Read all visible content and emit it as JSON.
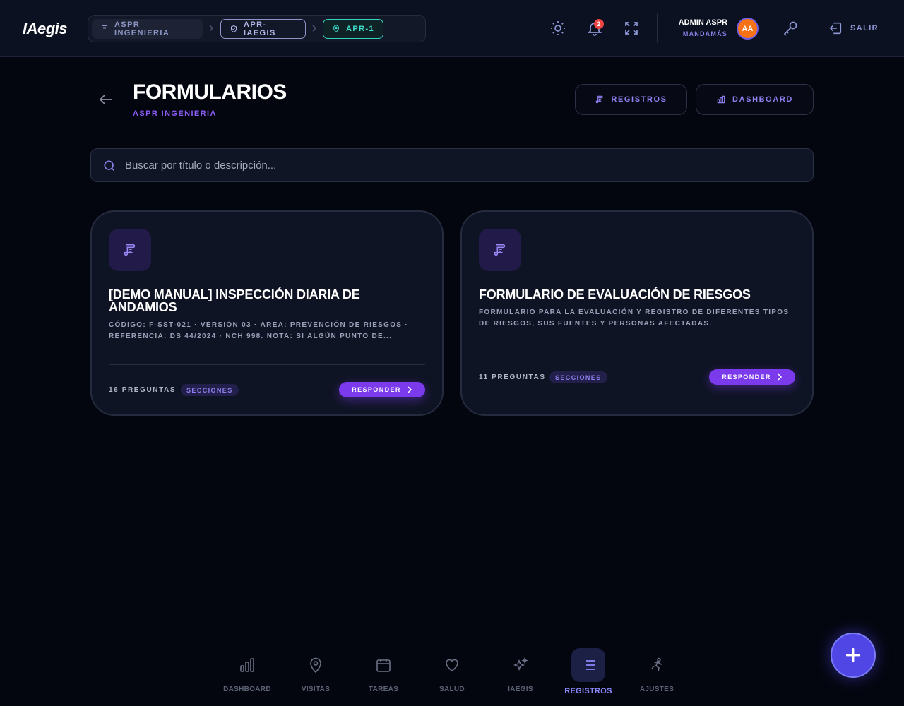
{
  "app": {
    "logo": "IAegis"
  },
  "breadcrumb": [
    {
      "label": "ASPR INGENIERIA",
      "icon": "building-icon"
    },
    {
      "label": "APR-IAEGIS",
      "icon": "shield-icon"
    },
    {
      "label": "APR-1",
      "icon": "map-pin-icon"
    }
  ],
  "notifications": {
    "count": "2"
  },
  "user": {
    "name": "ADMIN ASPR",
    "role": "MANDAMÁS",
    "initials": "AA"
  },
  "topbar": {
    "logout_label": "SALIR"
  },
  "header": {
    "title": "FORMULARIOS",
    "subtitle": "ASPR INGENIERIA",
    "registros_label": "REGISTROS",
    "dashboard_label": "DASHBOARD"
  },
  "search": {
    "placeholder": "Buscar por título o descripción..."
  },
  "forms": [
    {
      "title": "[DEMO MANUAL] INSPECCIÓN DIARIA DE ANDAMIOS",
      "description": "CÓDIGO: F-SST-021 · VERSIÓN 03 · ÁREA: PREVENCIÓN DE RIESGOS · REFERENCIA: DS 44/2024 · NCH 998. NOTA: SI ALGÚN PUNTO DE...",
      "questions": "16 PREGUNTAS",
      "tag": "SECCIONES",
      "action": "RESPONDER"
    },
    {
      "title": "FORMULARIO DE EVALUACIÓN DE RIESGOS",
      "description": "FORMULARIO PARA LA EVALUACIÓN Y REGISTRO DE DIFERENTES TIPOS DE RIESGOS, SUS FUENTES Y PERSONAS AFECTADAS.",
      "questions": "11 PREGUNTAS",
      "tag": "SECCIONES",
      "action": "RESPONDER"
    }
  ],
  "nav": [
    {
      "label": "DASHBOARD",
      "icon": "bar-chart-icon"
    },
    {
      "label": "VISITAS",
      "icon": "map-pin-icon"
    },
    {
      "label": "TAREAS",
      "icon": "calendar-icon"
    },
    {
      "label": "SALUD",
      "icon": "heart-icon"
    },
    {
      "label": "IAEGIS",
      "icon": "sparkles-icon"
    },
    {
      "label": "REGISTROS",
      "icon": "list-icon",
      "active": true
    },
    {
      "label": "AJUSTES",
      "icon": "runner-icon"
    }
  ],
  "colors": {
    "background": "#04060f",
    "topbar": "#0b1120",
    "accent": "#7c3aed",
    "fab": "#4f46e5",
    "teal": "#33d6c0",
    "avatar": "#f97316",
    "badge": "#ef4444"
  }
}
